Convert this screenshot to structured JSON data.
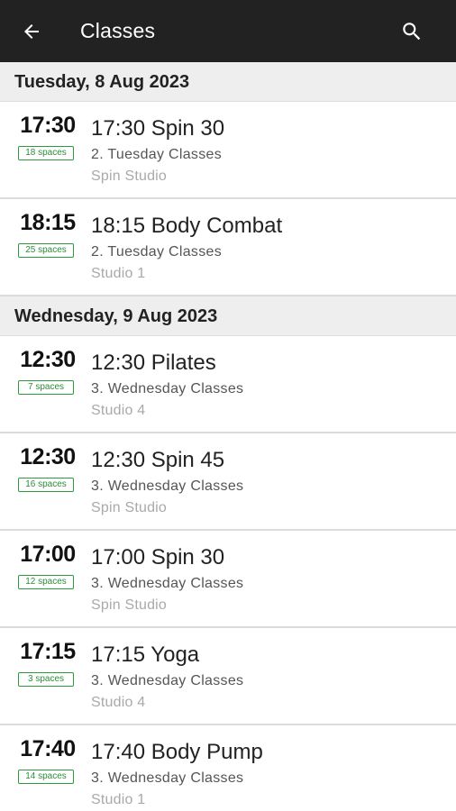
{
  "appbar": {
    "title": "Classes",
    "back_icon": "arrow-left-icon",
    "search_icon": "search-icon"
  },
  "colors": {
    "appbar_bg": "#222222",
    "spaces_green": "#2e9a3e",
    "header_bg": "#eeeeee"
  },
  "days": [
    {
      "label": "Tuesday, 8 Aug 2023",
      "classes": [
        {
          "time": "17:30",
          "spaces": "18 spaces",
          "name": "17:30 Spin 30",
          "category": "2. Tuesday Classes",
          "studio": "Spin Studio"
        },
        {
          "time": "18:15",
          "spaces": "25 spaces",
          "name": "18:15 Body Combat",
          "category": "2. Tuesday Classes",
          "studio": "Studio 1"
        }
      ]
    },
    {
      "label": "Wednesday, 9 Aug 2023",
      "classes": [
        {
          "time": "12:30",
          "spaces": "7 spaces",
          "name": "12:30 Pilates",
          "category": "3. Wednesday Classes",
          "studio": "Studio 4"
        },
        {
          "time": "12:30",
          "spaces": "16 spaces",
          "name": "12:30 Spin 45",
          "category": "3. Wednesday Classes",
          "studio": "Spin Studio"
        },
        {
          "time": "17:00",
          "spaces": "12 spaces",
          "name": "17:00 Spin 30",
          "category": "3. Wednesday Classes",
          "studio": "Spin Studio"
        },
        {
          "time": "17:15",
          "spaces": "3 spaces",
          "name": "17:15 Yoga",
          "category": "3. Wednesday Classes",
          "studio": "Studio 4"
        },
        {
          "time": "17:40",
          "spaces": "14 spaces",
          "name": "17:40 Body Pump",
          "category": "3. Wednesday Classes",
          "studio": "Studio 1"
        }
      ]
    }
  ]
}
